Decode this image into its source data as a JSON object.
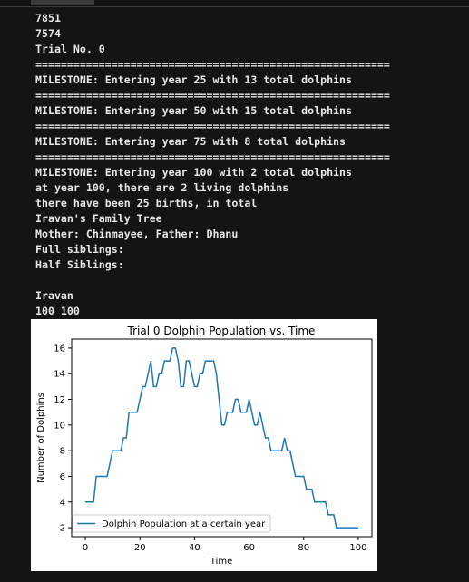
{
  "output_lines": [
    "7851",
    "7574",
    "Trial No. 0",
    "========================================================",
    "MILESTONE: Entering year 25 with 13 total dolphins",
    "========================================================",
    "MILESTONE: Entering year 50 with 15 total dolphins",
    "========================================================",
    "MILESTONE: Entering year 75 with 8 total dolphins",
    "========================================================",
    "MILESTONE: Entering year 100 with 2 total dolphins",
    "at year 100, there are 2 living dolphins",
    "there have been 25 births, in total",
    "Iravan's Family Tree",
    "Mother: Chinmayee, Father: Dhanu",
    "Full siblings:",
    "Half Siblings:",
    "",
    "Iravan",
    "100 100"
  ],
  "chart_data": {
    "type": "line",
    "title": "Trial 0 Dolphin Population vs. Time",
    "xlabel": "Time",
    "ylabel": "Number of Dolphins",
    "xlim": [
      -5,
      105
    ],
    "ylim": [
      1.3,
      16.7
    ],
    "xticks": [
      0,
      20,
      40,
      60,
      80,
      100
    ],
    "yticks": [
      2,
      4,
      6,
      8,
      10,
      12,
      14,
      16
    ],
    "grid": false,
    "legend_position": "lower left",
    "series": [
      {
        "name": "Dolphin Population at a certain year",
        "color": "#1f77b4",
        "x": [
          0,
          1,
          2,
          3,
          4,
          5,
          6,
          7,
          8,
          9,
          10,
          11,
          12,
          13,
          14,
          15,
          16,
          17,
          18,
          19,
          20,
          21,
          22,
          23,
          24,
          25,
          26,
          27,
          28,
          29,
          30,
          31,
          32,
          33,
          34,
          35,
          36,
          37,
          38,
          39,
          40,
          41,
          42,
          43,
          44,
          45,
          46,
          47,
          48,
          49,
          50,
          51,
          52,
          53,
          54,
          55,
          56,
          57,
          58,
          59,
          60,
          61,
          62,
          63,
          64,
          65,
          66,
          67,
          68,
          69,
          70,
          71,
          72,
          73,
          74,
          75,
          76,
          77,
          78,
          79,
          80,
          81,
          82,
          83,
          84,
          85,
          86,
          87,
          88,
          89,
          90,
          91,
          92,
          93,
          94,
          95,
          96,
          97,
          98,
          99,
          100
        ],
        "y": [
          4,
          4,
          4,
          4,
          6,
          6,
          6,
          6,
          6,
          7,
          8,
          8,
          8,
          8,
          9,
          9,
          11,
          11,
          11,
          11,
          12,
          13,
          13,
          14,
          15,
          13,
          13,
          14,
          14,
          15,
          15,
          15,
          16,
          16,
          15,
          13,
          13,
          15,
          15,
          14,
          13,
          13,
          14,
          14,
          15,
          15,
          15,
          15,
          14,
          12,
          10,
          10,
          11,
          11,
          11,
          12,
          12,
          11,
          11,
          11,
          12,
          11,
          10,
          10,
          11,
          10,
          9,
          9,
          8,
          8,
          8,
          8,
          8,
          9,
          8,
          8,
          7,
          6,
          6,
          6,
          6,
          5,
          5,
          5,
          4,
          4,
          4,
          4,
          4,
          3,
          3,
          3,
          2,
          2,
          2,
          2,
          2,
          2,
          2,
          2,
          2
        ]
      }
    ]
  }
}
